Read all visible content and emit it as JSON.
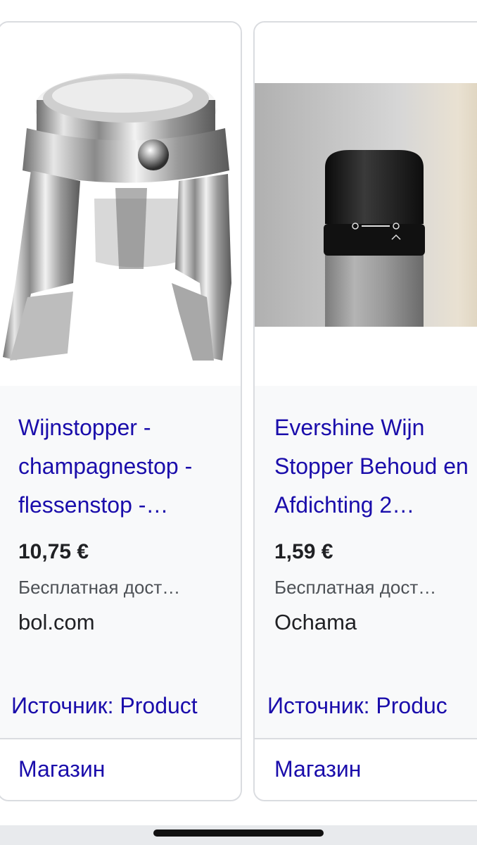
{
  "products": [
    {
      "title": "Wijnstopper - champagnestop - flessenstop -…",
      "price": "10,75 €",
      "shipping": "Бесплатная дост…",
      "merchant": "bol.com",
      "source": "Источник: Product",
      "store": "Магазин",
      "image": "stainless-champagne-stopper"
    },
    {
      "title": "Evershine Wijn Stopper Behoud en Afdichting 2…",
      "price": "1,59 €",
      "shipping": "Бесплатная дост…",
      "merchant": "Ochama",
      "source": "Источник: Produc",
      "store": "Магазин",
      "image": "black-vacuum-wine-stopper"
    }
  ],
  "colors": {
    "link": "#1a0dab",
    "text": "#202124",
    "muted": "#4d5156",
    "card_bg": "#f8f9fa",
    "border": "#dadce0"
  }
}
